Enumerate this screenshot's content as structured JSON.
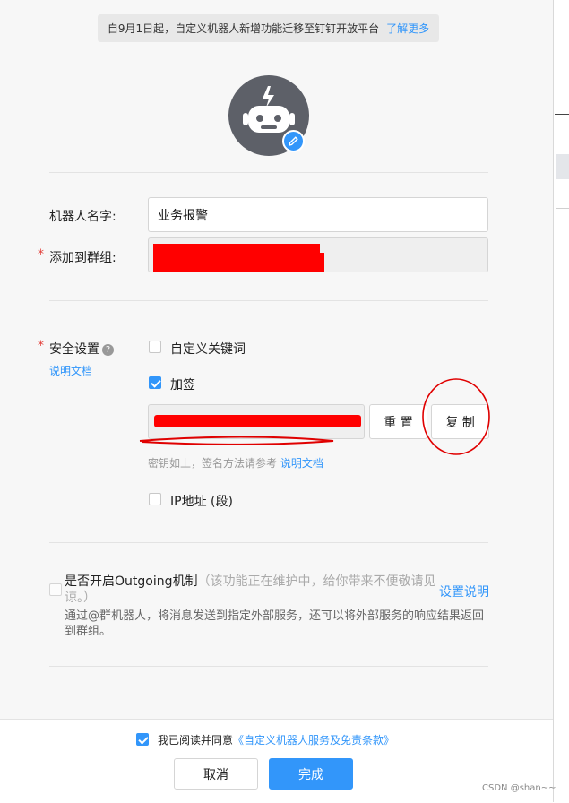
{
  "notice": {
    "text": "自9月1日起，自定义机器人新增功能迁移至钉钉开放平台",
    "link": "了解更多"
  },
  "avatar": {
    "icon": "robot-icon",
    "edit_icon": "pencil-icon"
  },
  "form": {
    "name_label": "机器人名字:",
    "name_value": "业务报警",
    "group_label": "添加到群组:",
    "required_mark": "*"
  },
  "security": {
    "label": "安全设置",
    "help_icon": "?",
    "doc_link": "说明文档",
    "keyword_label": "自定义关键词",
    "keyword_checked": false,
    "sign_label": "加签",
    "sign_checked": true,
    "reset_button": "重 置",
    "copy_button": "复 制",
    "hint_text": "密钥如上，签名方法请参考",
    "hint_link": "说明文档",
    "ip_label": "IP地址 (段)",
    "ip_checked": false
  },
  "outgoing": {
    "title": "是否开启Outgoing机制",
    "note": "（该功能正在维护中，给你带来不便敬请见谅。）",
    "settings_link": "设置说明",
    "description": "通过@群机器人，将消息发送到指定外部服务，还可以将外部服务的响应结果返回到群组。",
    "checked": false
  },
  "footer": {
    "agree_text": "我已阅读并同意",
    "agree_link": "《自定义机器人服务及免责条款》",
    "agree_checked": true,
    "cancel_button": "取消",
    "confirm_button": "完成"
  },
  "watermark": "CSDN @shan~~",
  "colors": {
    "accent": "#3296fa",
    "required": "#e2403b",
    "redaction": "#ff0000"
  }
}
